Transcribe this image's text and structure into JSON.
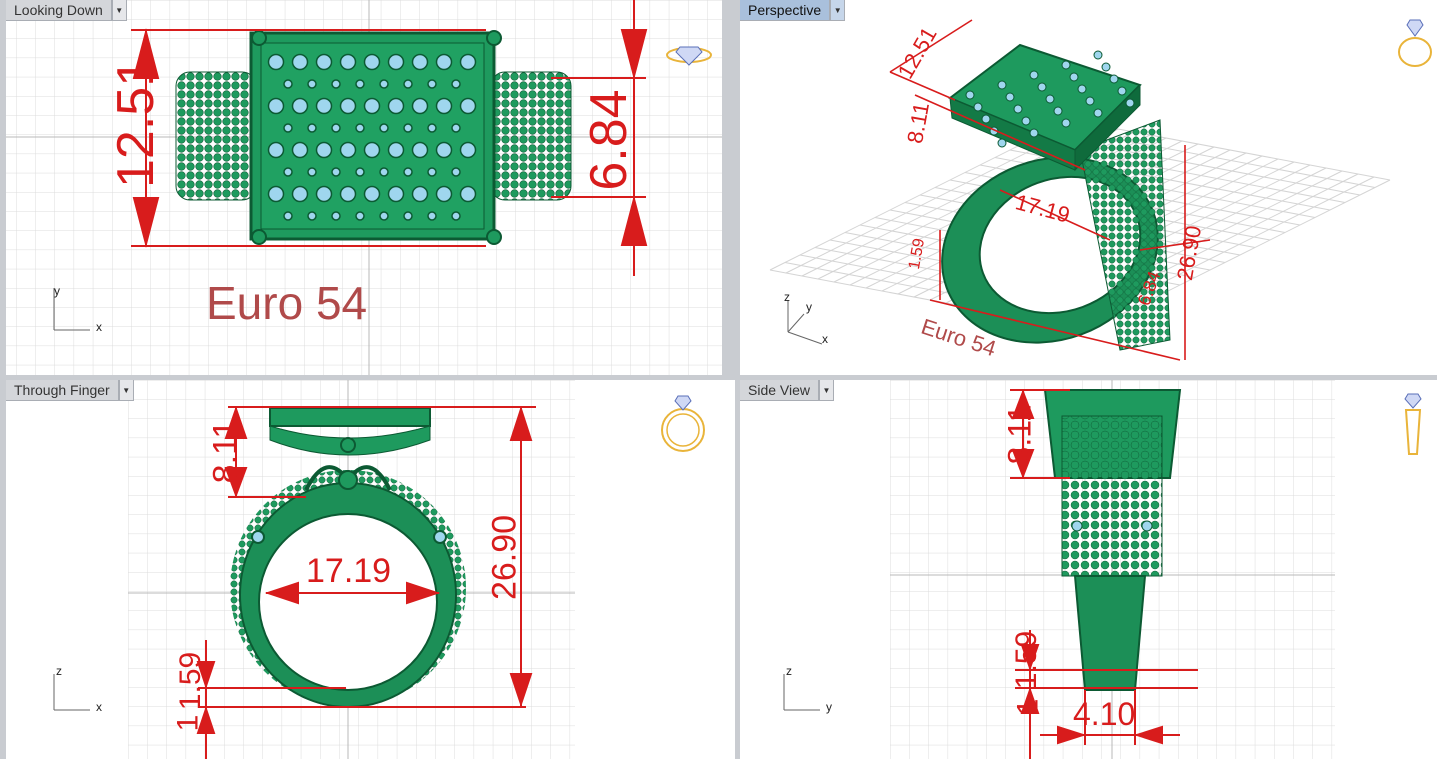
{
  "viewports": [
    {
      "label": "Looking Down",
      "active": false,
      "axis_h": "x",
      "axis_v": "y"
    },
    {
      "label": "Perspective",
      "active": true,
      "axis_h": "x",
      "axis_v": "z",
      "axis_d": "y"
    },
    {
      "label": "Through Finger",
      "active": false,
      "axis_h": "x",
      "axis_v": "z"
    },
    {
      "label": "Side View",
      "active": false,
      "axis_h": "y",
      "axis_v": "z"
    }
  ],
  "dimensions": {
    "top_height": "12.51",
    "top_band_width": "6.84",
    "perspective_top": "12.51",
    "perspective_head": "8.11",
    "perspective_diameter": "17.19",
    "perspective_height": "26.90",
    "perspective_bottom": "1.59",
    "perspective_side": "6.84",
    "finger_head": "8.11",
    "finger_diameter": "17.19",
    "finger_height": "26.90",
    "finger_shank": "1.59",
    "finger_base": "1",
    "side_head": "8.11",
    "side_shank": "1.59",
    "side_base": "1",
    "side_width": "4.10"
  },
  "size_label": "Euro 54",
  "colors": {
    "metal": "#1e9a5e",
    "metal_dark": "#0f6b3c",
    "stone": "#9fd6ee",
    "dimension": "#d81c1c",
    "grid_minor": "#dcdcdc",
    "grid_major": "#b8b8b8",
    "label_active": "#a9c0dc",
    "gold_icon": "#e9b43a"
  },
  "icons": [
    "diamond-ring-icon",
    "solitaire-ring-icon",
    "ring-front-icon",
    "ring-side-icon",
    "axis-icon"
  ]
}
